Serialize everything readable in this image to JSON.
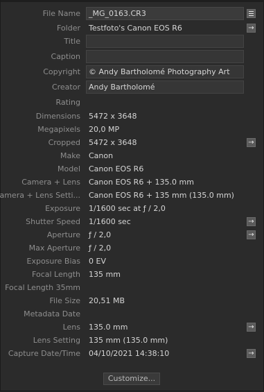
{
  "metadata": {
    "rows": [
      {
        "label": "File Name",
        "value": "_MG_0163.CR3"
      },
      {
        "label": "Folder",
        "value": "Testfoto's Canon EOS R6"
      },
      {
        "label": "Title",
        "value": ""
      },
      {
        "label": "Caption",
        "value": ""
      },
      {
        "label": "Copyright",
        "value": "© Andy Bartholomé Photography Art"
      },
      {
        "label": "Creator",
        "value": "Andy Bartholomé"
      },
      {
        "label": "Rating",
        "value": ""
      },
      {
        "label": "Dimensions",
        "value": "5472 x 3648"
      },
      {
        "label": "Megapixels",
        "value": "20,0 MP"
      },
      {
        "label": "Cropped",
        "value": "5472 x 3648"
      },
      {
        "label": "Make",
        "value": "Canon"
      },
      {
        "label": "Model",
        "value": "Canon EOS R6"
      },
      {
        "label": "Camera + Lens",
        "value": "Canon EOS R6 + 135.0 mm"
      },
      {
        "label": "Camera + Lens Setti...",
        "value": "Canon EOS R6 + 135 mm (135.0 mm)"
      },
      {
        "label": "Exposure",
        "value": "1/1600 sec at ƒ / 2,0"
      },
      {
        "label": "Shutter Speed",
        "value": "1/1600 sec"
      },
      {
        "label": "Aperture",
        "value": "ƒ / 2,0"
      },
      {
        "label": "Max Aperture",
        "value": "ƒ / 2,0"
      },
      {
        "label": "Exposure Bias",
        "value": "0 EV"
      },
      {
        "label": "Focal Length",
        "value": "135 mm"
      },
      {
        "label": "Focal Length 35mm",
        "value": ""
      },
      {
        "label": "File Size",
        "value": "20,51 MB"
      },
      {
        "label": "Metadata Date",
        "value": ""
      },
      {
        "label": "Lens",
        "value": "135.0 mm"
      },
      {
        "label": "Lens Setting",
        "value": "135 mm (135.0 mm)"
      },
      {
        "label": "Capture Date/Time",
        "value": "04/10/2021 14:38:10"
      }
    ]
  },
  "icons": {
    "arrow": "→",
    "list": "list-icon"
  },
  "footer": {
    "customize_label": "Customize..."
  },
  "colors": {
    "panel_bg": "#2b2b2b",
    "label": "#8e8e8e",
    "value": "#d6d6d6"
  }
}
